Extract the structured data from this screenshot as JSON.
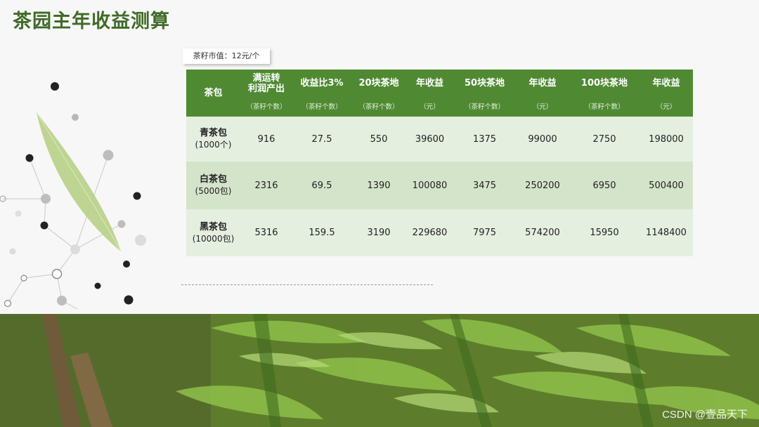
{
  "title": "茶园主年收益测算",
  "note": "茶籽市值：12元/个",
  "table": {
    "header_first": "茶包",
    "columns": [
      {
        "label_line1": "满运转",
        "label_line2": "利润产出",
        "unit": "（茶籽个数）"
      },
      {
        "label": "收益比3%",
        "unit": "（茶籽个数）"
      },
      {
        "label": "20块茶地",
        "unit": "（茶籽个数）"
      },
      {
        "label": "年收益",
        "unit": "（元）"
      },
      {
        "label": "50块茶地",
        "unit": "（茶籽个数）"
      },
      {
        "label": "年收益",
        "unit": "（元）"
      },
      {
        "label": "100块茶地",
        "unit": "（茶籽个数）"
      },
      {
        "label": "年收益",
        "unit": "（元）"
      }
    ],
    "rows": [
      {
        "name": "青茶包",
        "sub": "(1000个)",
        "values": [
          "916",
          "27.5",
          "550",
          "39600",
          "1375",
          "99000",
          "2750",
          "198000"
        ]
      },
      {
        "name": "白茶包",
        "sub": "(5000包)",
        "values": [
          "2316",
          "69.5",
          "1390",
          "100080",
          "3475",
          "250200",
          "6950",
          "500400"
        ]
      },
      {
        "name": "黑茶包",
        "sub": "(10000包)",
        "values": [
          "5316",
          "159.5",
          "3190",
          "229680",
          "7975",
          "574200",
          "15950",
          "1148400"
        ]
      }
    ]
  },
  "watermark": "CSDN @壹品天下",
  "colors": {
    "title": "#3f6b28",
    "header_bg": "#4f8a33",
    "row_light": "#e5efe0",
    "row_mid": "#d4e4ca"
  }
}
